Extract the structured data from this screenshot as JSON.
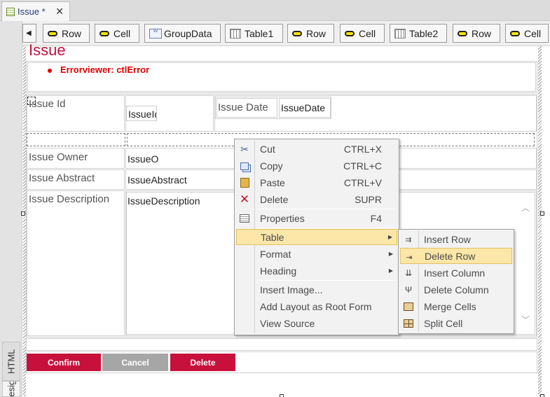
{
  "document_tab": {
    "title": "Issue *",
    "close": "✕"
  },
  "side_tabs": {
    "html": "HTML",
    "design": "Design"
  },
  "breadcrumbs": {
    "back_arrow": "◀",
    "items": [
      {
        "label": "Row",
        "icon": "row-pill-icon"
      },
      {
        "label": "Cell",
        "icon": "cell-pill-icon"
      },
      {
        "label": "GroupData",
        "icon": "groupdata-icon"
      },
      {
        "label": "Table1",
        "icon": "table-grid-icon"
      },
      {
        "label": "Row",
        "icon": "row-pill-icon"
      },
      {
        "label": "Cell",
        "icon": "cell-pill-icon"
      },
      {
        "label": "Table2",
        "icon": "table-grid-icon"
      },
      {
        "label": "Row",
        "icon": "row-pill-icon"
      },
      {
        "label": "Cell",
        "icon": "cell-pill-icon"
      }
    ]
  },
  "form": {
    "title": "Issue",
    "error_viewer": "Errorviewer: ctlError",
    "fields": {
      "issue_id_label": "Issue Id",
      "issue_id_control": "IssueId",
      "issue_date_label": "Issue Date",
      "issue_date_control": "IssueDate",
      "issue_owner_label": "Issue Owner",
      "issue_owner_control": "IssueO",
      "issue_abstract_label": "Issue Abstract",
      "issue_abstract_control": "IssueAbstract",
      "issue_description_label": "Issue Description",
      "issue_description_control": "IssueDescription"
    },
    "buttons": {
      "confirm": "Confirm",
      "cancel": "Cancel",
      "delete": "Delete"
    }
  },
  "context_menu": {
    "items": [
      {
        "label": "Cut",
        "shortcut": "CTRL+X",
        "icon": "scissors-icon"
      },
      {
        "label": "Copy",
        "shortcut": "CTRL+C",
        "icon": "copy-icon"
      },
      {
        "label": "Paste",
        "shortcut": "CTRL+V",
        "icon": "paste-icon"
      },
      {
        "label": "Delete",
        "shortcut": "SUPR",
        "icon": "delete-x-icon"
      },
      {
        "label": "Properties",
        "shortcut": "F4",
        "icon": "properties-icon"
      },
      {
        "label": "Table",
        "has_submenu": true
      },
      {
        "label": "Format",
        "has_submenu": true
      },
      {
        "label": "Heading",
        "has_submenu": true
      },
      {
        "label": "Insert Image..."
      },
      {
        "label": "Add Layout as Root Form"
      },
      {
        "label": "View Source"
      }
    ],
    "highlighted": "Table"
  },
  "table_submenu": {
    "items": [
      {
        "label": "Insert Row",
        "icon": "insert-row-icon"
      },
      {
        "label": "Delete Row",
        "icon": "delete-row-icon"
      },
      {
        "label": "Insert Column",
        "icon": "insert-column-icon"
      },
      {
        "label": "Delete Column",
        "icon": "delete-column-icon"
      },
      {
        "label": "Merge Cells",
        "icon": "merge-cells-icon"
      },
      {
        "label": "Split Cell",
        "icon": "split-cell-icon"
      }
    ],
    "highlighted": "Delete Row"
  },
  "colors": {
    "brand": "#c8103c",
    "error": "#e00000",
    "cancel": "#a6a6a6",
    "menu_highlight": "#fde7a8"
  }
}
